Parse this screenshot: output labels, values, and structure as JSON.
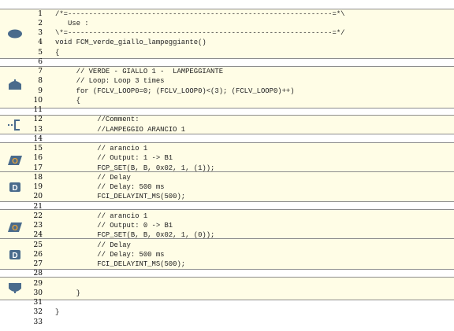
{
  "colors": {
    "block_background": "#fffde6",
    "block_border": "#8c8c8c",
    "icon_fill": "#4a6b8c",
    "icon_fill_accent": "#e7a33a"
  },
  "editor": {
    "lines": [
      {
        "n": "1",
        "text": "/*=---------------------------------------------------------------=*\\"
      },
      {
        "n": "2",
        "text": "   Use :"
      },
      {
        "n": "3",
        "text": "\\*=---------------------------------------------------------------=*/"
      },
      {
        "n": "4",
        "text": "void FCM_verde_giallo_lampeggiante()"
      },
      {
        "n": "5",
        "text": "{"
      },
      {
        "n": "6",
        "text": ""
      },
      {
        "n": "7",
        "text": "     // VERDE - GIALLO 1 -  LAMPEGGIANTE"
      },
      {
        "n": "8",
        "text": "     // Loop: Loop 3 times"
      },
      {
        "n": "9",
        "text": "     for (FCLV_LOOP0=0; (FCLV_LOOP0)<(3); (FCLV_LOOP0)++)"
      },
      {
        "n": "10",
        "text": "     {"
      },
      {
        "n": "11",
        "text": ""
      },
      {
        "n": "12",
        "text": "          //Comment:"
      },
      {
        "n": "13",
        "text": "          //LAMPEGGIO ARANCIO 1"
      },
      {
        "n": "14",
        "text": ""
      },
      {
        "n": "15",
        "text": "          // arancio 1"
      },
      {
        "n": "16",
        "text": "          // Output: 1 -> B1"
      },
      {
        "n": "17",
        "text": "          FCP_SET(B, B, 0x02, 1, (1));"
      },
      {
        "n": "18",
        "text": "          // Delay"
      },
      {
        "n": "19",
        "text": "          // Delay: 500 ms"
      },
      {
        "n": "20",
        "text": "          FCI_DELAYINT_MS(500);"
      },
      {
        "n": "21",
        "text": ""
      },
      {
        "n": "22",
        "text": "          // arancio 1"
      },
      {
        "n": "23",
        "text": "          // Output: 0 -> B1"
      },
      {
        "n": "24",
        "text": "          FCP_SET(B, B, 0x02, 1, (0));"
      },
      {
        "n": "25",
        "text": "          // Delay"
      },
      {
        "n": "26",
        "text": "          // Delay: 500 ms"
      },
      {
        "n": "27",
        "text": "          FCI_DELAYINT_MS(500);"
      },
      {
        "n": "28",
        "text": ""
      },
      {
        "n": "29",
        "text": ""
      },
      {
        "n": "30",
        "text": "     }"
      },
      {
        "n": "31",
        "text": ""
      },
      {
        "n": "32",
        "text": "}"
      },
      {
        "n": "33",
        "text": ""
      }
    ],
    "icons": [
      {
        "name": "begin-terminator-icon"
      },
      {
        "name": "loop-start-icon"
      },
      {
        "name": "comment-icon"
      },
      {
        "name": "output-icon"
      },
      {
        "name": "delay-icon"
      },
      {
        "name": "output-icon"
      },
      {
        "name": "delay-icon"
      },
      {
        "name": "loop-end-icon"
      }
    ]
  }
}
